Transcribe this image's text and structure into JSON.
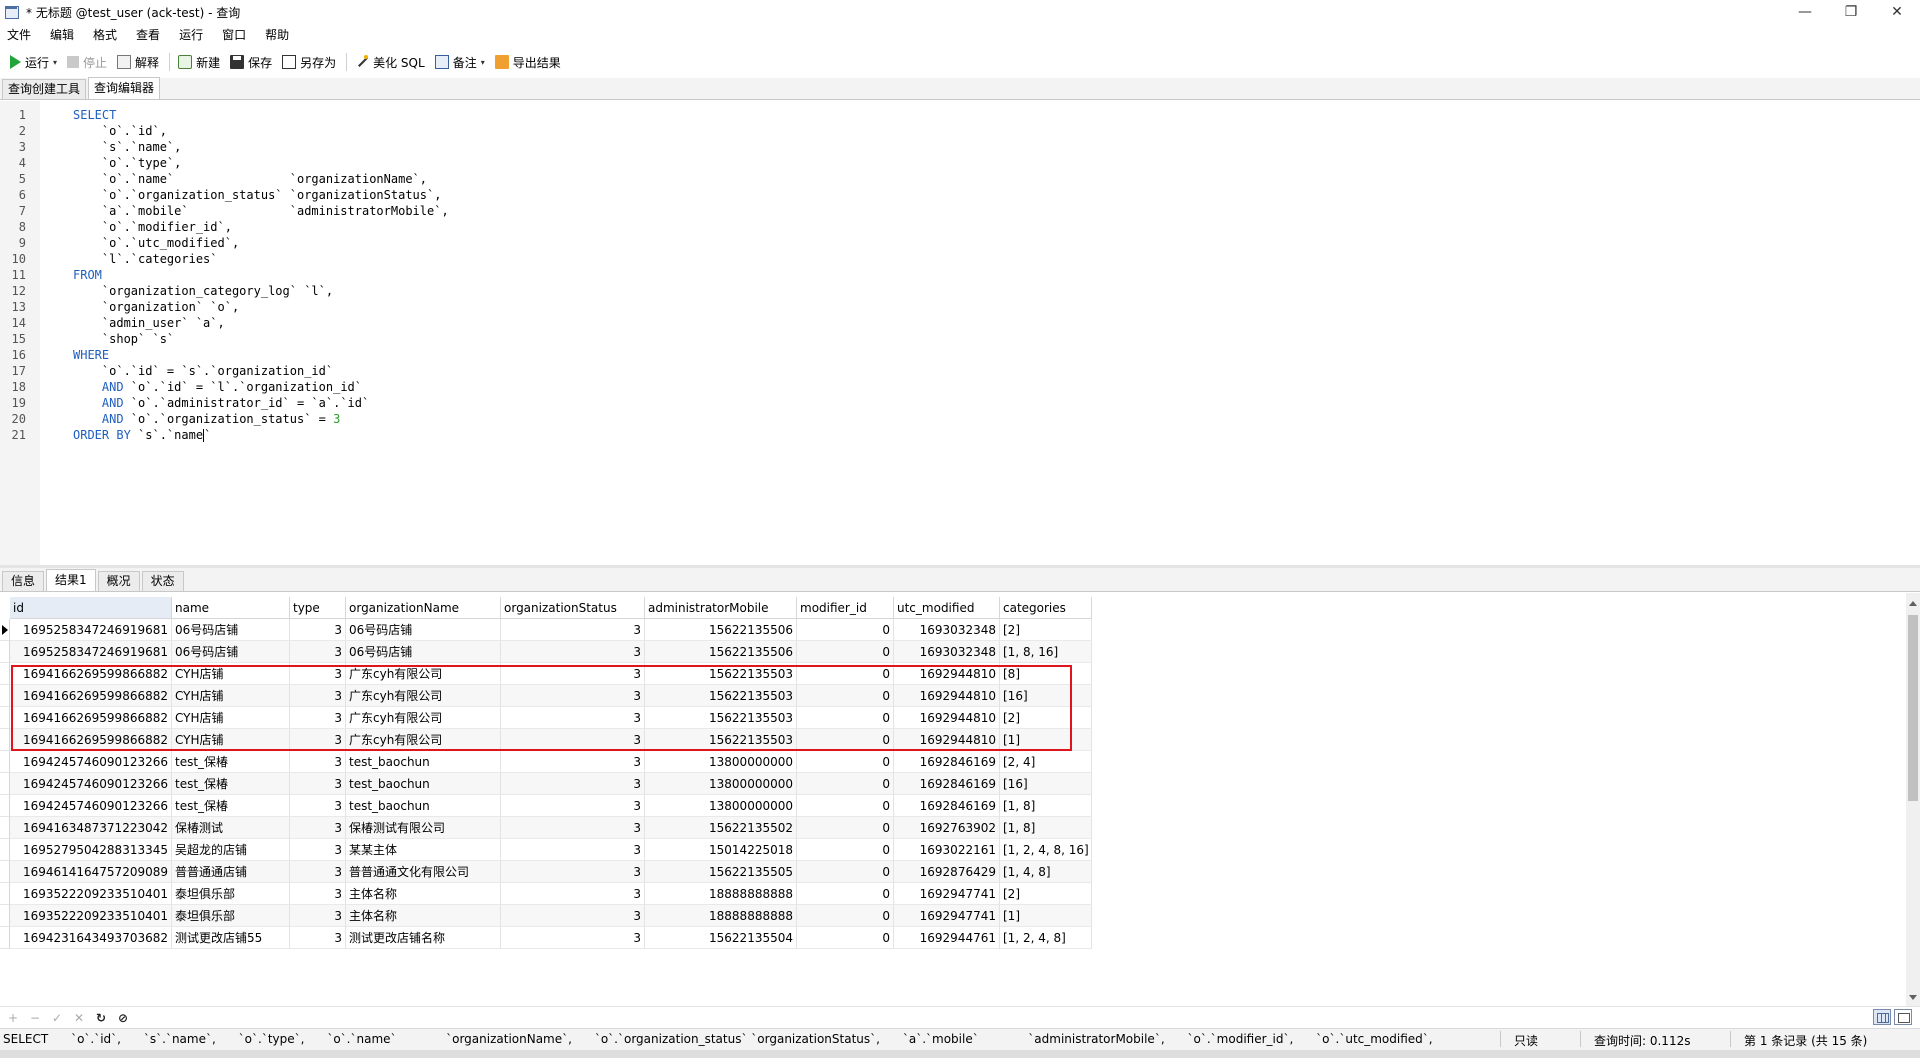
{
  "window": {
    "title": "* 无标题 @test_user (ack-test) - 查询",
    "controls": {
      "minimize": "—",
      "restore": "❐",
      "close": "✕"
    }
  },
  "menu": [
    "文件",
    "编辑",
    "格式",
    "查看",
    "运行",
    "窗口",
    "帮助"
  ],
  "toolbar": {
    "run": "运行",
    "stop": "停止",
    "explain": "解释",
    "new": "新建",
    "save": "保存",
    "save_as": "另存为",
    "beautify": "美化 SQL",
    "comment": "备注",
    "export": "导出结果",
    "caret": "▾"
  },
  "editor_tabs": [
    "查询创建工具",
    "查询编辑器"
  ],
  "code_lines": [
    {
      "n": "1",
      "parts": [
        {
          "t": "SELECT",
          "c": "kw"
        }
      ]
    },
    {
      "n": "2",
      "parts": [
        {
          "t": "    `o`.`id`,"
        }
      ]
    },
    {
      "n": "3",
      "parts": [
        {
          "t": "    `s`.`name`,"
        }
      ]
    },
    {
      "n": "4",
      "parts": [
        {
          "t": "    `o`.`type`,"
        }
      ]
    },
    {
      "n": "5",
      "parts": [
        {
          "t": "    `o`.`name`                `organizationName`,"
        }
      ]
    },
    {
      "n": "6",
      "parts": [
        {
          "t": "    `o`.`organization_status` `organizationStatus`,"
        }
      ]
    },
    {
      "n": "7",
      "parts": [
        {
          "t": "    `a`.`mobile`              `administratorMobile`,"
        }
      ]
    },
    {
      "n": "8",
      "parts": [
        {
          "t": "    `o`.`modifier_id`,"
        }
      ]
    },
    {
      "n": "9",
      "parts": [
        {
          "t": "    `o`.`utc_modified`,"
        }
      ]
    },
    {
      "n": "10",
      "parts": [
        {
          "t": "    `l`.`categories`"
        }
      ]
    },
    {
      "n": "11",
      "parts": [
        {
          "t": "FROM",
          "c": "kw"
        }
      ]
    },
    {
      "n": "12",
      "parts": [
        {
          "t": "    `organization_category_log` `l`,"
        }
      ]
    },
    {
      "n": "13",
      "parts": [
        {
          "t": "    `organization` `o`,"
        }
      ]
    },
    {
      "n": "14",
      "parts": [
        {
          "t": "    `admin_user` `a`,"
        }
      ]
    },
    {
      "n": "15",
      "parts": [
        {
          "t": "    `shop` `s`"
        }
      ]
    },
    {
      "n": "16",
      "parts": [
        {
          "t": "WHERE",
          "c": "kw"
        }
      ]
    },
    {
      "n": "17",
      "parts": [
        {
          "t": "    `o`.`id` = `s`.`organization_id`"
        }
      ]
    },
    {
      "n": "18",
      "parts": [
        {
          "t": "    "
        },
        {
          "t": "AND",
          "c": "kw"
        },
        {
          "t": " `o`.`id` = `l`.`organization_id`"
        }
      ]
    },
    {
      "n": "19",
      "parts": [
        {
          "t": "    "
        },
        {
          "t": "AND",
          "c": "kw"
        },
        {
          "t": " `o`.`administrator_id` = `a`.`id`"
        }
      ]
    },
    {
      "n": "20",
      "parts": [
        {
          "t": "    "
        },
        {
          "t": "AND",
          "c": "kw"
        },
        {
          "t": " `o`.`organization_status` = "
        },
        {
          "t": "3",
          "c": "num"
        }
      ]
    },
    {
      "n": "21",
      "parts": [
        {
          "t": "ORDER BY",
          "c": "kw"
        },
        {
          "t": " `s`.`name"
        },
        {
          "t": "",
          "c": "caret"
        },
        {
          "t": "`"
        }
      ]
    }
  ],
  "result_tabs": [
    "信息",
    "结果1",
    "概况",
    "状态"
  ],
  "grid": {
    "columns": [
      "id",
      "name",
      "type",
      "organizationName",
      "organizationStatus",
      "administratorMobile",
      "modifier_id",
      "utc_modified",
      "categories"
    ],
    "rows": [
      [
        "1695258347246919681",
        "06号码店铺",
        "3",
        "06号码店铺",
        "3",
        "15622135506",
        "0",
        "1693032348",
        "[2]"
      ],
      [
        "1695258347246919681",
        "06号码店铺",
        "3",
        "06号码店铺",
        "3",
        "15622135506",
        "0",
        "1693032348",
        "[1, 8, 16]"
      ],
      [
        "1694166269599866882",
        "CYH店铺",
        "3",
        "广东cyh有限公司",
        "3",
        "15622135503",
        "0",
        "1692944810",
        "[8]"
      ],
      [
        "1694166269599866882",
        "CYH店铺",
        "3",
        "广东cyh有限公司",
        "3",
        "15622135503",
        "0",
        "1692944810",
        "[16]"
      ],
      [
        "1694166269599866882",
        "CYH店铺",
        "3",
        "广东cyh有限公司",
        "3",
        "15622135503",
        "0",
        "1692944810",
        "[2]"
      ],
      [
        "1694166269599866882",
        "CYH店铺",
        "3",
        "广东cyh有限公司",
        "3",
        "15622135503",
        "0",
        "1692944810",
        "[1]"
      ],
      [
        "1694245746090123266",
        "test_保椿",
        "3",
        "test_baochun",
        "3",
        "13800000000",
        "0",
        "1692846169",
        "[2, 4]"
      ],
      [
        "1694245746090123266",
        "test_保椿",
        "3",
        "test_baochun",
        "3",
        "13800000000",
        "0",
        "1692846169",
        "[16]"
      ],
      [
        "1694245746090123266",
        "test_保椿",
        "3",
        "test_baochun",
        "3",
        "13800000000",
        "0",
        "1692846169",
        "[1, 8]"
      ],
      [
        "1694163487371223042",
        "保椿测试",
        "3",
        "保椿测试有限公司",
        "3",
        "15622135502",
        "0",
        "1692763902",
        "[1, 8]"
      ],
      [
        "1695279504288313345",
        "吴超龙的店铺",
        "3",
        "某某主体",
        "3",
        "15014225018",
        "0",
        "1693022161",
        "[1, 2, 4, 8, 16]"
      ],
      [
        "1694614164757209089",
        "普普通通店铺",
        "3",
        "普普通通文化有限公司",
        "3",
        "15622135505",
        "0",
        "1692876429",
        "[1, 4, 8]"
      ],
      [
        "1693522209233510401",
        "泰坦俱乐部",
        "3",
        "主体名称",
        "3",
        "18888888888",
        "0",
        "1692947741",
        "[2]"
      ],
      [
        "1693522209233510401",
        "泰坦俱乐部",
        "3",
        "主体名称",
        "3",
        "18888888888",
        "0",
        "1692947741",
        "[1]"
      ],
      [
        "1694231643493703682",
        "测试更改店铺55",
        "3",
        "测试更改店铺名称",
        "3",
        "15622135504",
        "0",
        "1692944761",
        "[1, 2, 4, 8]"
      ]
    ]
  },
  "navigator": {
    "add": "+",
    "delete": "−",
    "apply": "✓",
    "discard": "✕",
    "refresh": "↻",
    "stop": "⊘"
  },
  "status": {
    "sql": "SELECT      `o`.`id`,      `s`.`name`,      `o`.`type`,      `o`.`name`             `organizationName`,      `o`.`organization_status` `organizationStatus`,      `a`.`mobile`             `administratorMobile`,      `o`.`modifier_id`,      `o`.`utc_modified`,",
    "readonly": "只读",
    "time": "查询时间: 0.112s",
    "record": "第 1 条记录 (共 15 条)"
  },
  "colors": {
    "keyword": "#1f5fbf",
    "number": "#2a9d2a",
    "highlight_border": "#e0141e",
    "run_icon": "#22a43a"
  }
}
